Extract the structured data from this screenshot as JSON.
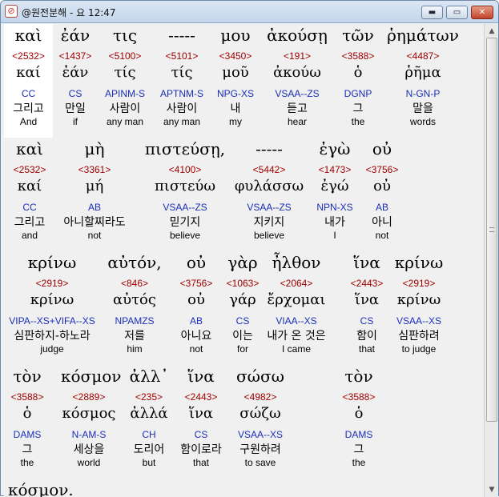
{
  "window": {
    "title": "@원전분해 - 요 12:47",
    "min_glyph": "▬",
    "max_glyph": "▭",
    "close_glyph": "✕",
    "app_icon_glyph": "⊘"
  },
  "scroll": {
    "up_glyph": "▲",
    "down_glyph": "▼"
  },
  "rows": [
    {
      "words": [
        {
          "greek": "καὶ",
          "strong": "",
          "lemma": "καί",
          "parse": "CC",
          "korean": "그리고",
          "english": "And"
        },
        {
          "greek": "ἐάν",
          "strong": "<1437>",
          "lemma": "ἐάν",
          "parse": "CS",
          "korean": "만일",
          "english": "if"
        },
        {
          "greek": "τις",
          "strong": "<5100>",
          "lemma": "τίς",
          "parse": "APINM-S",
          "korean": "사람이",
          "english": "any man"
        },
        {
          "greek": "-----",
          "strong": "<5101>",
          "lemma": "τίς",
          "parse": "APTNM-S",
          "korean": "사람이",
          "english": "any man"
        },
        {
          "greek": "μου",
          "strong": "<3450>",
          "lemma": "μοῦ",
          "parse": "NPG-XS",
          "korean": "내",
          "english": "my"
        },
        {
          "greek": "ἀκούσῃ",
          "strong": "<191>",
          "lemma": "ἀκούω",
          "parse": "VSAA--ZS",
          "korean": "듣고",
          "english": "hear"
        },
        {
          "greek": "τῶν",
          "strong": "<3588>",
          "lemma": "ὁ",
          "parse": "DGNP",
          "korean": "그",
          "english": "the"
        },
        {
          "greek": "ῥημάτων",
          "strong": "<4487>",
          "lemma": "ῥῆμα",
          "parse": "N-GN-P",
          "korean": "말을",
          "english": "words"
        }
      ],
      "first_strong": "<2532>"
    },
    {
      "words": [
        {
          "greek": "καὶ",
          "strong": "<2532>",
          "lemma": "καί",
          "parse": "CC",
          "korean": "그리고",
          "english": "and"
        },
        {
          "greek": "μὴ",
          "strong": "<3361>",
          "lemma": "μή",
          "parse": "AB",
          "korean": "아니할찌라도",
          "english": "not"
        },
        {
          "greek": "πιστεύσῃ,",
          "strong": "<4100>",
          "lemma": "πιστεύω",
          "parse": "VSAA--ZS",
          "korean": "믿기지",
          "english": "believe"
        },
        {
          "greek": "-----",
          "strong": "<5442>",
          "lemma": "φυλάσσω",
          "parse": "VSAA--ZS",
          "korean": "지키지",
          "english": "believe"
        },
        {
          "greek": "ἐγὼ",
          "strong": "<1473>",
          "lemma": "ἐγώ",
          "parse": "NPN-XS",
          "korean": "내가",
          "english": "I"
        },
        {
          "greek": "οὐ",
          "strong": "<3756>",
          "lemma": "οὐ",
          "parse": "AB",
          "korean": "아니",
          "english": "not"
        }
      ]
    },
    {
      "words": [
        {
          "greek": "κρίνω",
          "strong": "<2919>",
          "lemma": "κρίνω",
          "parse": "VIPA--XS+VIFA--XS",
          "korean": "심판하지-하노라",
          "english": "judge"
        },
        {
          "greek": "αὐτόν,",
          "strong": "<846>",
          "lemma": "αὐτός",
          "parse": "NPAMZS",
          "korean": "저를",
          "english": "him"
        },
        {
          "greek": "οὐ",
          "strong": "<3756>",
          "lemma": "οὐ",
          "parse": "AB",
          "korean": "아니요",
          "english": "not"
        },
        {
          "greek": "γὰρ",
          "strong": "<1063>",
          "lemma": "γάρ",
          "parse": "CS",
          "korean": "이는",
          "english": "for"
        },
        {
          "greek": "ἦλθον",
          "strong": "<2064>",
          "lemma": "ἔρχομαι",
          "parse": "VIAA--XS",
          "korean": "내가 온 것은",
          "english": "I came"
        },
        {
          "greek": "ἵνα",
          "strong": "<2443>",
          "lemma": "ἵνα",
          "parse": "CS",
          "korean": "함이",
          "english": "that"
        },
        {
          "greek": "κρίνω",
          "strong": "<2919>",
          "lemma": "κρίνω",
          "parse": "VSAA--XS",
          "korean": "심판하려",
          "english": "to judge"
        }
      ]
    },
    {
      "words": [
        {
          "greek": "τὸν",
          "strong": "<3588>",
          "lemma": "ὁ",
          "parse": "DAMS",
          "korean": "그",
          "english": "the"
        },
        {
          "greek": "κόσμον",
          "strong": "<2889>",
          "lemma": "κόσμος",
          "parse": "N-AM-S",
          "korean": "세상을",
          "english": "world"
        },
        {
          "greek": "ἀλλ᾽",
          "strong": "<235>",
          "lemma": "ἀλλά",
          "parse": "CH",
          "korean": "도리어",
          "english": "but"
        },
        {
          "greek": "ἵνα",
          "strong": "<2443>",
          "lemma": "ἵνα",
          "parse": "CS",
          "korean": "함이로라",
          "english": "that"
        },
        {
          "greek": "σώσω",
          "strong": "<4982>",
          "lemma": "σώζω",
          "parse": "VSAA--XS",
          "korean": "구원하려",
          "english": "to save"
        },
        {
          "greek": "τὸν",
          "strong": "<3588>",
          "lemma": "ὁ",
          "parse": "DAMS",
          "korean": "그",
          "english": "the"
        }
      ]
    },
    {
      "words": [
        {
          "greek": "κόσμον.",
          "strong": "",
          "lemma": "",
          "parse": "",
          "korean": "",
          "english": ""
        }
      ]
    }
  ]
}
